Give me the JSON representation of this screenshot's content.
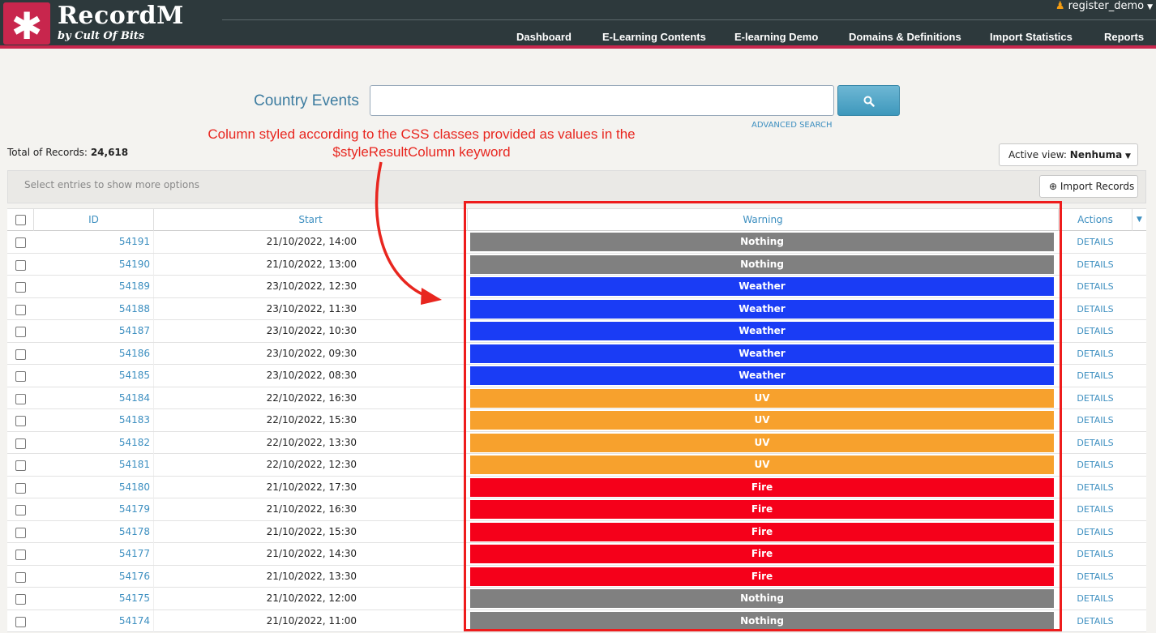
{
  "header": {
    "brand": "RecordM",
    "brand_sub": "by Cult Of Bits",
    "user": "register_demo",
    "nav": [
      "Dashboard",
      "E-Learning Contents",
      "E-learning Demo",
      "Domains & Definitions",
      "Import Statistics",
      "Reports"
    ]
  },
  "search": {
    "label": "Country Events",
    "value": "",
    "advanced": "ADVANCED SEARCH"
  },
  "annotation": {
    "line1": "Column styled according to the CSS classes provided as values in the",
    "line2": "$styleResultColumn keyword"
  },
  "total": {
    "label": "Total of Records:",
    "value": "24,618"
  },
  "active_view": {
    "label": "Active view:",
    "value": "Nenhuma"
  },
  "options_text": "Select entries to show more options",
  "import_label": "Import Records",
  "columns": {
    "id": "ID",
    "start": "Start",
    "warning": "Warning",
    "actions": "Actions"
  },
  "warning_colors": {
    "Nothing": "#808080",
    "Weather": "#1a3cf5",
    "UV": "#f7a12d",
    "Fire": "#f5001a"
  },
  "rows": [
    {
      "id": "54191",
      "start": "21/10/2022, 14:00",
      "warning": "Nothing",
      "action": "DETAILS"
    },
    {
      "id": "54190",
      "start": "21/10/2022, 13:00",
      "warning": "Nothing",
      "action": "DETAILS"
    },
    {
      "id": "54189",
      "start": "23/10/2022, 12:30",
      "warning": "Weather",
      "action": "DETAILS"
    },
    {
      "id": "54188",
      "start": "23/10/2022, 11:30",
      "warning": "Weather",
      "action": "DETAILS"
    },
    {
      "id": "54187",
      "start": "23/10/2022, 10:30",
      "warning": "Weather",
      "action": "DETAILS"
    },
    {
      "id": "54186",
      "start": "23/10/2022, 09:30",
      "warning": "Weather",
      "action": "DETAILS"
    },
    {
      "id": "54185",
      "start": "23/10/2022, 08:30",
      "warning": "Weather",
      "action": "DETAILS"
    },
    {
      "id": "54184",
      "start": "22/10/2022, 16:30",
      "warning": "UV",
      "action": "DETAILS"
    },
    {
      "id": "54183",
      "start": "22/10/2022, 15:30",
      "warning": "UV",
      "action": "DETAILS"
    },
    {
      "id": "54182",
      "start": "22/10/2022, 13:30",
      "warning": "UV",
      "action": "DETAILS"
    },
    {
      "id": "54181",
      "start": "22/10/2022, 12:30",
      "warning": "UV",
      "action": "DETAILS"
    },
    {
      "id": "54180",
      "start": "21/10/2022, 17:30",
      "warning": "Fire",
      "action": "DETAILS"
    },
    {
      "id": "54179",
      "start": "21/10/2022, 16:30",
      "warning": "Fire",
      "action": "DETAILS"
    },
    {
      "id": "54178",
      "start": "21/10/2022, 15:30",
      "warning": "Fire",
      "action": "DETAILS"
    },
    {
      "id": "54177",
      "start": "21/10/2022, 14:30",
      "warning": "Fire",
      "action": "DETAILS"
    },
    {
      "id": "54176",
      "start": "21/10/2022, 13:30",
      "warning": "Fire",
      "action": "DETAILS"
    },
    {
      "id": "54175",
      "start": "21/10/2022, 12:00",
      "warning": "Nothing",
      "action": "DETAILS"
    },
    {
      "id": "54174",
      "start": "21/10/2022, 11:00",
      "warning": "Nothing",
      "action": "DETAILS"
    }
  ]
}
